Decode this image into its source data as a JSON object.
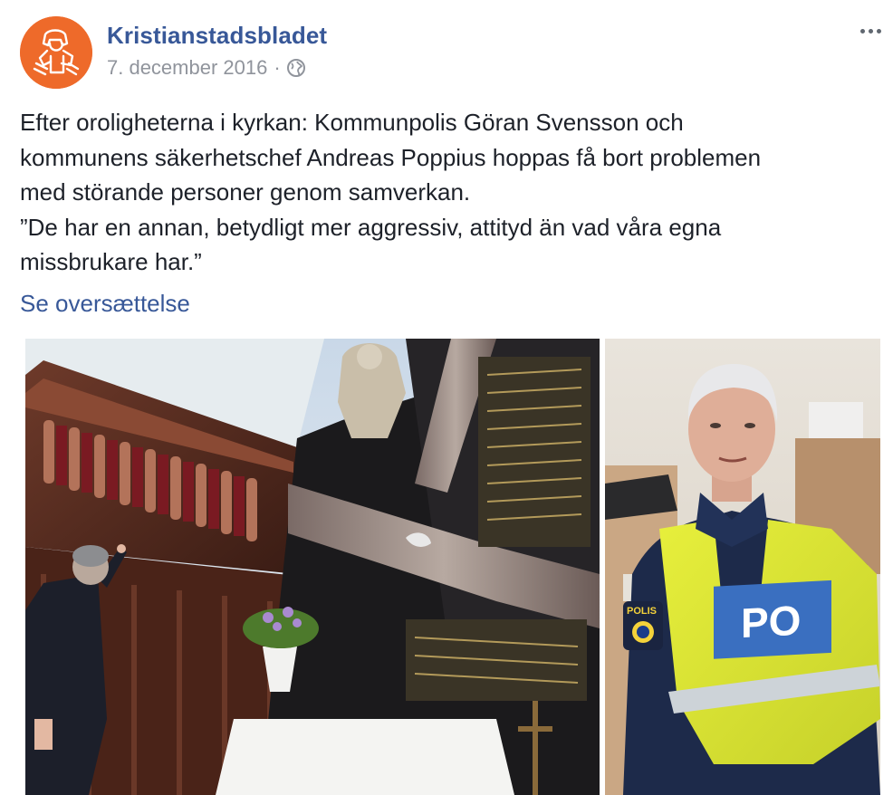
{
  "post": {
    "page_name": "Kristianstadsbladet",
    "date": "7. december 2016",
    "separator": "·",
    "privacy_icon": "globe-icon",
    "more_icon": "more-options-icon",
    "text_lines": [
      "Efter oroligheterna i kyrkan: Kommunpolis Göran Svensson och",
      "kommunens säkerhetschef Andreas Poppius hoppas få bort problemen",
      "med störande personer genom samverkan.",
      "”De har en annan, betydligt mer aggressiv, attityd än vad våra egna",
      "missbrukare har.”"
    ],
    "translate_link": "Se oversættelse",
    "photos": [
      {
        "name": "church-interior-photo",
        "subject": "man pointing at church altar and gallery"
      },
      {
        "name": "police-officer-photo",
        "subject": "police officer in yellow vest with POLIS patch"
      }
    ],
    "colors": {
      "link": "#385898",
      "text": "#1d2129",
      "meta": "#90949c",
      "avatar_bg": "#ee6a2a"
    }
  }
}
